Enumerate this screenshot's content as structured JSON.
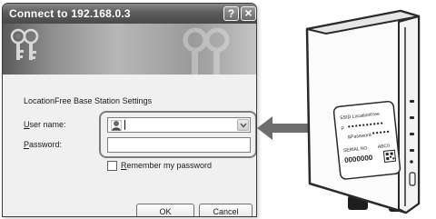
{
  "dialog": {
    "title": "Connect to 192.168.0.3",
    "help_button": "?",
    "close_button": "×",
    "heading": "LocationFree Base Station Settings",
    "user_label": {
      "mnemonic": "U",
      "rest": "ser name:"
    },
    "password_label": {
      "mnemonic": "P",
      "rest": "assword:"
    },
    "user_value": "",
    "password_value": "",
    "remember_checked": false,
    "remember_label": {
      "mnemonic": "R",
      "rest": "emember my password"
    },
    "ok_label": "OK",
    "cancel_label": "Cancel"
  },
  "device": {
    "label_lines": [
      "SSID LocationFree",
      "P",
      "&Password",
      "SERIAL NO.",
      "0000000",
      "ABC0"
    ]
  },
  "colors": {
    "titlebar": "#5c5c5c",
    "dialog_body": "#f0f0f0",
    "arrow": "#6e6e6e",
    "highlight_border": "#7c7c7c"
  },
  "icons": [
    "keys-icon",
    "help-icon",
    "close-icon",
    "user-icon",
    "chevron-down-icon",
    "arrow-left-icon"
  ]
}
